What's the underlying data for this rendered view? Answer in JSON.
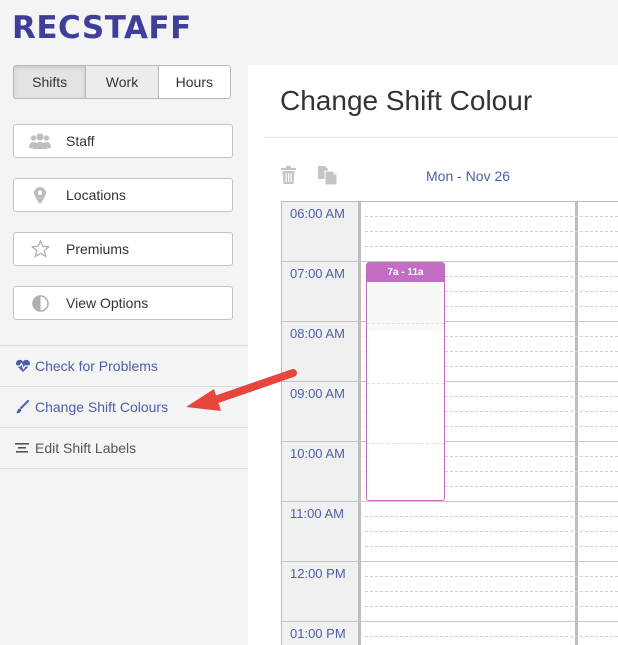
{
  "app": {
    "logo": "RECSTAFF"
  },
  "tabs": [
    {
      "label": "Shifts"
    },
    {
      "label": "Work"
    },
    {
      "label": "Hours"
    }
  ],
  "sidebar": {
    "buttons": [
      {
        "label": "Staff",
        "icon": "users-icon"
      },
      {
        "label": "Locations",
        "icon": "map-pin-icon"
      },
      {
        "label": "Premiums",
        "icon": "star-icon"
      },
      {
        "label": "View Options",
        "icon": "contrast-icon"
      }
    ],
    "links": [
      {
        "label": "Check for Problems",
        "icon": "heartbeat-icon"
      },
      {
        "label": "Change Shift Colours",
        "icon": "paintbrush-icon"
      },
      {
        "label": "Edit Shift Labels",
        "icon": "align-center-icon"
      }
    ]
  },
  "main": {
    "title": "Change Shift Colour",
    "day_label": "Mon - Nov 26",
    "times": [
      "06:00 AM",
      "07:00 AM",
      "08:00 AM",
      "09:00 AM",
      "10:00 AM",
      "11:00 AM",
      "12:00 PM",
      "01:00 PM"
    ],
    "shift": {
      "label": "7a - 11a",
      "color": "#c36ec4"
    }
  },
  "colors": {
    "accent": "#4b60a8",
    "brand": "#3f3f9a",
    "annotation_arrow": "#e5473f"
  }
}
